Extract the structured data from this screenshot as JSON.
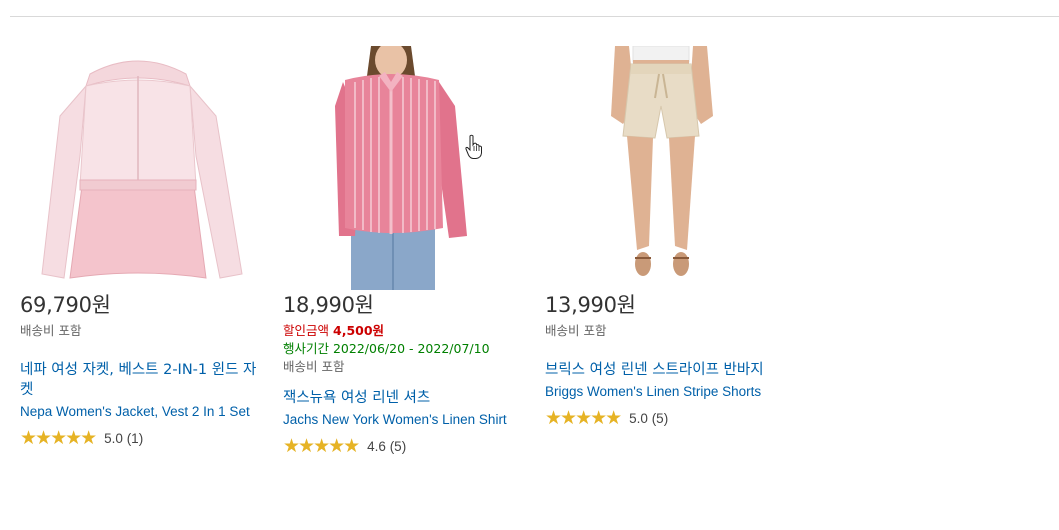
{
  "products": [
    {
      "price": "69,790원",
      "shipping": "배송비 포함",
      "name_ko": "네파 여성 자켓, 베스트 2-IN-1 윈드 자켓",
      "name_en": "Nepa Women's Jacket, Vest 2 In 1 Set",
      "stars": "★★★★★",
      "rating": "5.0 (1)"
    },
    {
      "price": "18,990원",
      "discount_label": "할인금액",
      "discount_amount": "4,500원",
      "period": "행사기간 2022/06/20 - 2022/07/10",
      "shipping": "배송비 포함",
      "name_ko": "잭스뉴욕 여성 리넨 셔츠",
      "name_en": "Jachs New York Women's Linen Shirt",
      "stars": "★★★★★",
      "rating": "4.6 (5)"
    },
    {
      "price": "13,990원",
      "shipping": "배송비 포함",
      "name_ko": "브릭스 여성 린넨 스트라이프 반바지",
      "name_en": "Briggs Women's Linen Stripe Shorts",
      "stars": "★★★★★",
      "rating": "5.0 (5)"
    }
  ],
  "colors": {
    "link": "#0060a9",
    "discount": "#cc0000",
    "period": "#008000",
    "star": "#e6b325"
  }
}
